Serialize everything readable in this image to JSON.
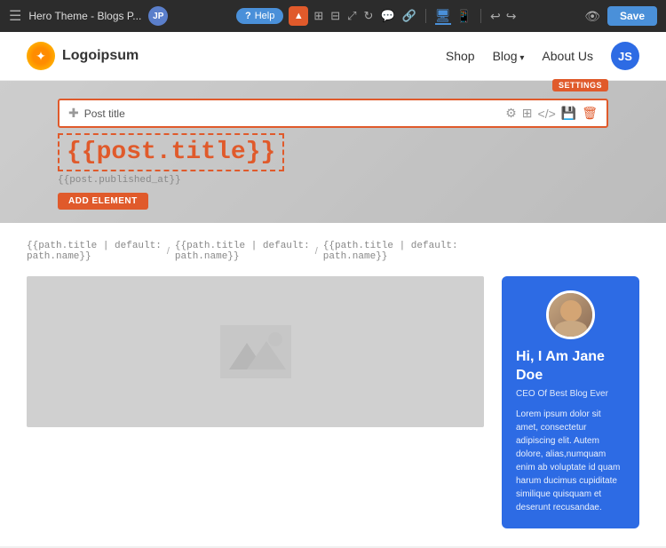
{
  "toolbar": {
    "title": "Hero Theme - Blogs P...",
    "help_label": "Help",
    "save_label": "Save",
    "avatar_initials": "JP"
  },
  "navbar": {
    "logo_text": "Logoipsum",
    "links": [
      {
        "label": "Shop",
        "has_arrow": false
      },
      {
        "label": "Blog",
        "has_arrow": true
      },
      {
        "label": "About Us",
        "has_arrow": false
      }
    ],
    "user_initials": "JS"
  },
  "hero": {
    "settings_label": "SETTINGS",
    "post_title_bar_label": "Post title",
    "title_template": "{{post.title}}",
    "published_template": "{{post.published_at}}",
    "add_element_label": "ADD ELEMENT"
  },
  "breadcrumb": {
    "items": [
      {
        "text": "{{path.title | default:",
        "text2": "path.name}}",
        "is_link": false
      },
      {
        "text": "{{path.title | default:",
        "text2": "path.name}}",
        "is_link": false
      },
      {
        "text": "{{path.title | default:",
        "text2": "path.name}}",
        "is_link": true
      }
    ]
  },
  "sidebar_card": {
    "greeting": "Hi, I Am Jane Doe",
    "role": "CEO Of Best Blog Ever",
    "bio": "Lorem ipsum dolor sit amet, consectetur adipiscing elit. Autem dolore, alias,numquam enim ab voluptate id quam harum ducimus cupiditate similique quisquam et deserunt recusandae."
  }
}
